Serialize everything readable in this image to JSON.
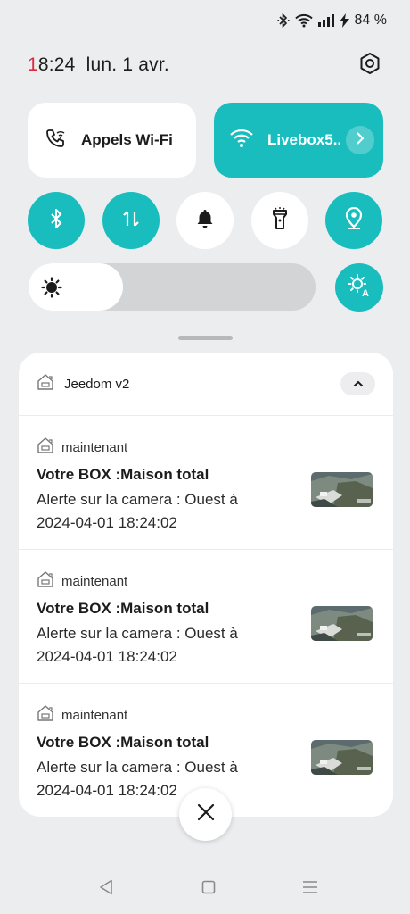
{
  "status_bar": {
    "battery_percent": "84 %",
    "icons": [
      "bluetooth-icon",
      "wifi-icon",
      "signal-icon",
      "charging-icon"
    ]
  },
  "header": {
    "time_first_digit": "1",
    "time_rest": "8:24",
    "date": "lun. 1 avr.",
    "settings_icon": "gear-icon"
  },
  "quick_tiles": {
    "wifi_calling": {
      "label": "Appels Wi-Fi",
      "icon": "wifi-call-icon",
      "active": false
    },
    "wifi": {
      "label": "Livebox5..",
      "icon": "wifi-icon",
      "active": true
    }
  },
  "toggles": [
    {
      "name": "bluetooth",
      "icon": "bluetooth-icon",
      "active": true
    },
    {
      "name": "mobile-data",
      "icon": "data-arrows-icon",
      "active": true
    },
    {
      "name": "sound",
      "icon": "bell-icon",
      "active": false
    },
    {
      "name": "flashlight",
      "icon": "flashlight-icon",
      "active": false
    },
    {
      "name": "location",
      "icon": "location-icon",
      "active": true
    }
  ],
  "brightness": {
    "level": 0.33,
    "icon": "sun-icon",
    "auto_icon": "auto-brightness-icon"
  },
  "notifications": {
    "app_name": "Jeedom v2",
    "items": [
      {
        "time": "maintenant",
        "title": "Votre BOX :Maison total",
        "body": "Alerte sur la camera : Ouest à 2024-04-01 18:24:02"
      },
      {
        "time": "maintenant",
        "title": "Votre BOX :Maison total",
        "body": "Alerte sur la camera : Ouest à 2024-04-01 18:24:02"
      },
      {
        "time": "maintenant",
        "title": "Votre BOX :Maison total",
        "body": "Alerte sur la camera : Ouest à 2024-04-01 18:24:02"
      }
    ]
  },
  "colors": {
    "accent": "#19bdbd",
    "background": "#ecedef",
    "clock_red": "#e0293f"
  },
  "nav": [
    "back-icon",
    "home-icon",
    "recents-icon"
  ]
}
